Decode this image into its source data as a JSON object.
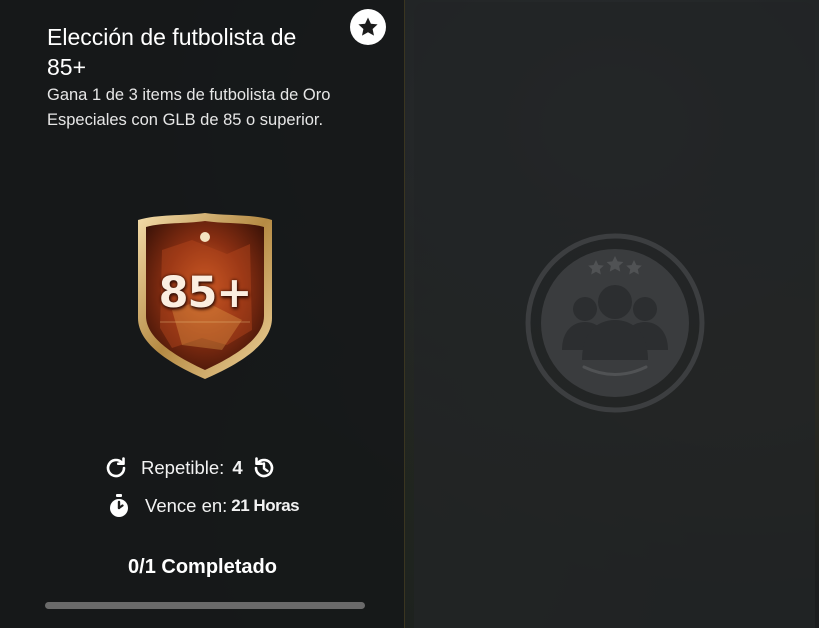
{
  "objective": {
    "title": "Elección de futbolista de 85+",
    "description": "Gana 1 de 3 items de futbolista de Oro Especiales con GLB de 85 o superior.",
    "pack_label": "85+",
    "repeatable_label": "Repetible:",
    "repeatable_count": "4",
    "expires_label": "Vence en:",
    "expires_value": "21 Horas",
    "progress_text": "0/1 Completado",
    "progress_fraction": 0
  },
  "icons": {
    "favorite": "star-icon",
    "repeat": "refresh-icon",
    "history": "history-icon",
    "timer": "stopwatch-icon",
    "placeholder": "squad-silhouette-icon"
  },
  "colors": {
    "gold": "#d4b35a",
    "panel": "#161819",
    "track": "#6a6a6a"
  }
}
